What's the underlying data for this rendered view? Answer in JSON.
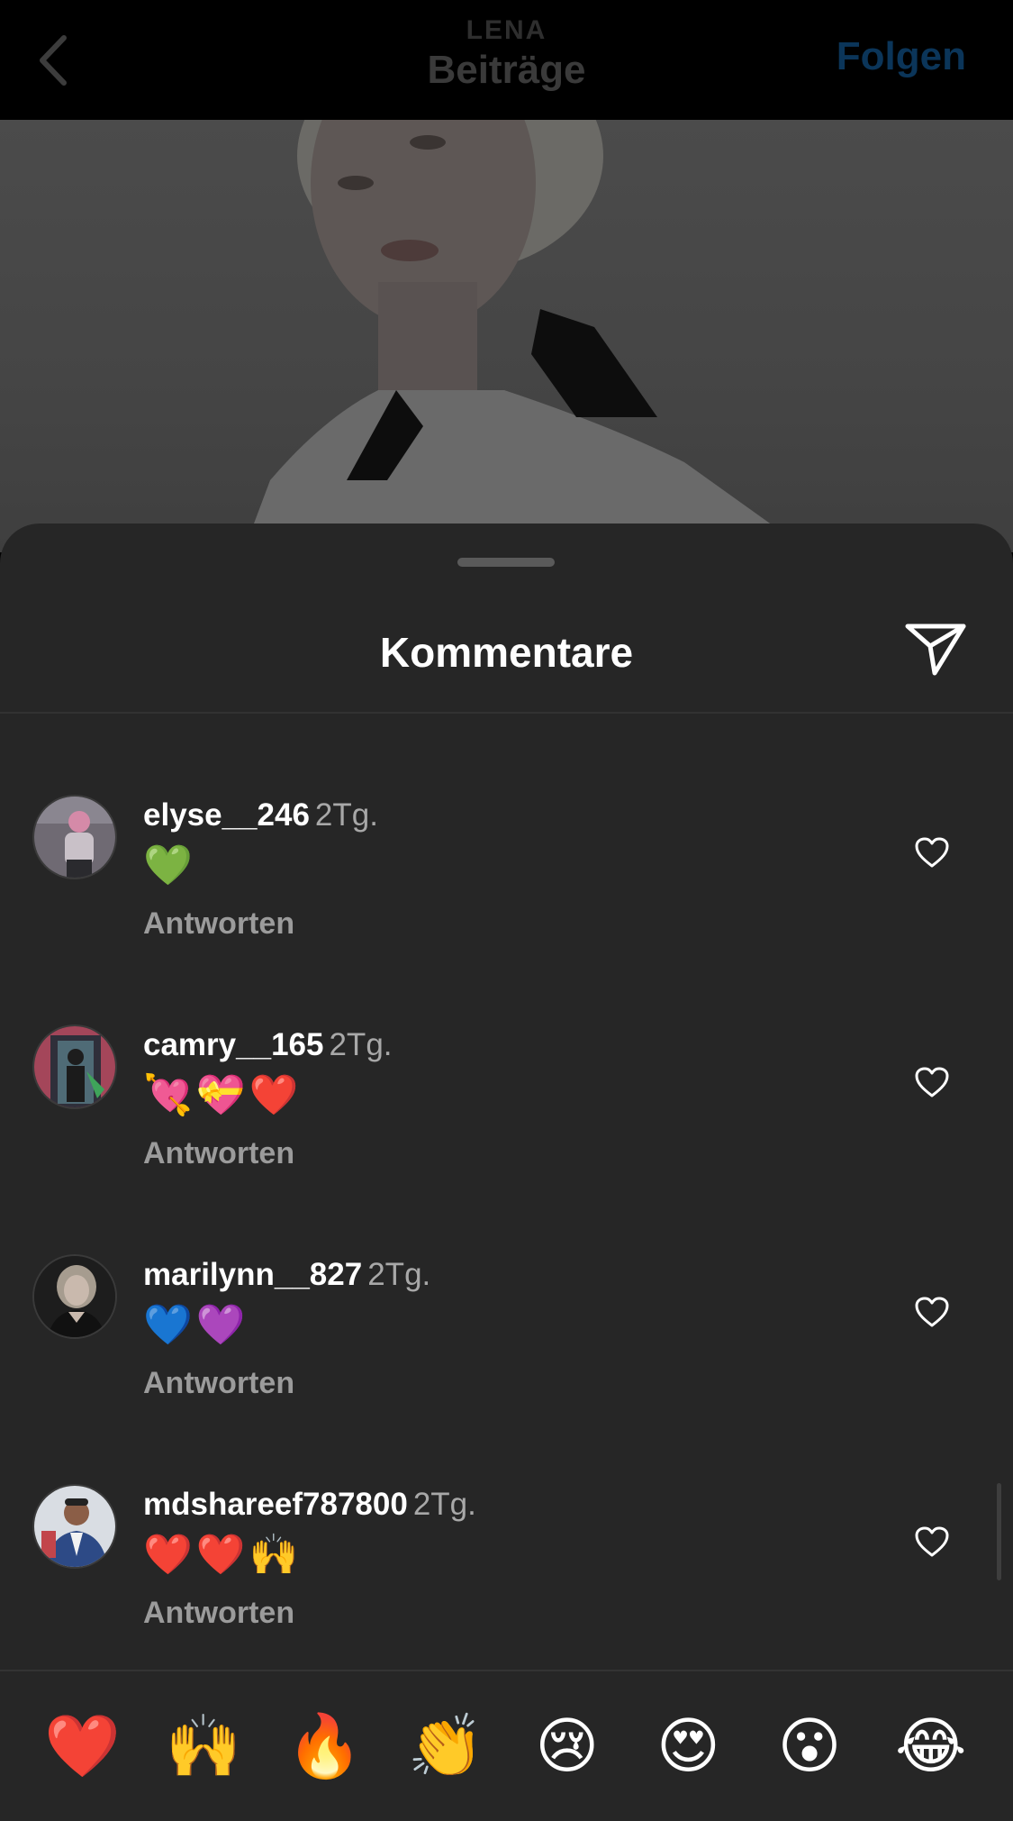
{
  "nav": {
    "subtitle": "LENA",
    "title": "Beiträge",
    "follow_label": "Folgen"
  },
  "sheet": {
    "title": "Kommentare"
  },
  "comments": [
    {
      "username": "elyse__246",
      "time": "2Tg.",
      "text": "💚",
      "reply_label": "Antworten"
    },
    {
      "username": "camry__165",
      "time": "2Tg.",
      "text": "💘💝❤️",
      "reply_label": "Antworten"
    },
    {
      "username": "marilynn__827",
      "time": "2Tg.",
      "text": "💙💜",
      "reply_label": "Antworten"
    },
    {
      "username": "mdshareef787800",
      "time": "2Tg.",
      "text": "❤️❤️🙌",
      "reply_label": "Antworten"
    }
  ],
  "emoji_bar": [
    "❤️",
    "🙌",
    "🔥",
    "👏",
    "😢",
    "😍",
    "😮",
    "😂"
  ],
  "colors": {
    "sheet_bg": "#262626",
    "follow": "#0b3559",
    "secondary_text": "#a8a8a8"
  }
}
